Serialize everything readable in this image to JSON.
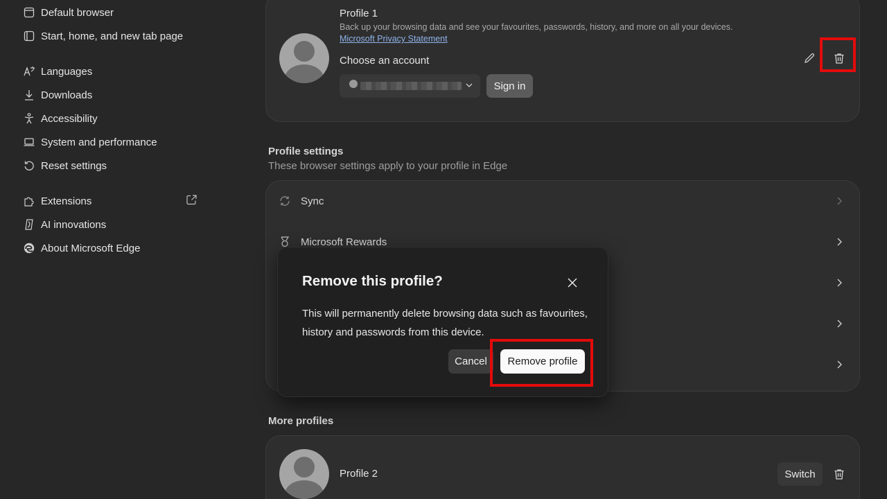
{
  "sidebar": {
    "items": [
      {
        "label": "Default browser",
        "icon": "browser-window-icon"
      },
      {
        "label": "Start, home, and new tab page",
        "icon": "home-page-icon"
      },
      {
        "label": "Languages",
        "icon": "languages-icon"
      },
      {
        "label": "Downloads",
        "icon": "download-icon"
      },
      {
        "label": "Accessibility",
        "icon": "accessibility-icon"
      },
      {
        "label": "System and performance",
        "icon": "laptop-icon"
      },
      {
        "label": "Reset settings",
        "icon": "reset-icon"
      },
      {
        "label": "Extensions",
        "icon": "puzzle-icon"
      },
      {
        "label": "AI innovations",
        "icon": "ai-icon"
      },
      {
        "label": "About Microsoft Edge",
        "icon": "edge-logo-icon"
      }
    ]
  },
  "profile": {
    "name": "Profile 1",
    "description": "Back up your browsing data and see your favourites, passwords, history, and more on all your devices.",
    "privacy_link": "Microsoft Privacy Statement",
    "choose_account_label": "Choose an account",
    "sign_in_label": "Sign in"
  },
  "profile_settings": {
    "title": "Profile settings",
    "subtitle": "These browser settings apply to your profile in Edge",
    "rows": [
      {
        "label": "Sync",
        "icon": "sync-icon"
      },
      {
        "label": "Microsoft Rewards",
        "icon": "rewards-medal-icon"
      }
    ]
  },
  "dialog": {
    "title": "Remove this profile?",
    "body": "This will permanently delete browsing data such as favourites, history and passwords from this device.",
    "cancel_label": "Cancel",
    "remove_label": "Remove profile"
  },
  "more_profiles": {
    "title": "More profiles",
    "profiles": [
      {
        "name": "Profile 2",
        "switch_label": "Switch"
      }
    ]
  },
  "colors": {
    "background": "#272727",
    "card": "#2e2e2e",
    "dialog": "#202020",
    "highlight": "#e30b0b",
    "link": "#8fb3ea"
  }
}
